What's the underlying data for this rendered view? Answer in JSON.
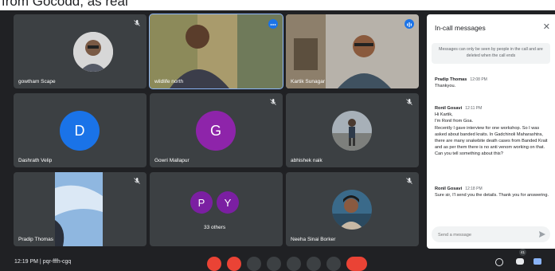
{
  "banner": {
    "text": "from Gocodd, as real"
  },
  "tiles": [
    {
      "name": "gowtham Scape"
    },
    {
      "name": "wildlife north"
    },
    {
      "name": "Kartik Sunagar"
    },
    {
      "name": "Dashrath Velip",
      "initial": "D",
      "color": "#1a73e8"
    },
    {
      "name": "Gowri Mallapur",
      "initial": "G",
      "color": "#8e24aa"
    },
    {
      "name": "abhishek naik"
    },
    {
      "name": "Pradip Thomas"
    },
    {
      "name": "33 others",
      "initials": [
        "P",
        "Y"
      ],
      "colors": [
        "#7b1fa2",
        "#7b1fa2"
      ]
    },
    {
      "name": "Neeha Sinai Borker"
    }
  ],
  "panel": {
    "title": "In-call messages",
    "note": "Messages can only be seen by people in the call and are deleted when the call ends",
    "messages": [
      {
        "sender": "Pradip Thomas",
        "time": "12:08 PM",
        "text": "Thankyou."
      },
      {
        "sender": "Ronil Gosavi",
        "time": "12:11 PM",
        "text": "Hi Kartik,\nI'm Ronil from Goa.\nRecently I gave interview for one workshop. So I was asked about banded kraits. In Gadchinoli Maharashtra, there are many snakebite death cases from Banded Krait and as per them there is no anti venom working on that. Can you tell something about this?"
      },
      {
        "sender": "Ronil Gosavi",
        "time": "12:18 PM",
        "text": "Sure sir, I'l send you the details. Thank you  for answering."
      }
    ],
    "input_placeholder": "Send a message"
  },
  "bottom": {
    "time": "12:19 PM",
    "meeting_code": "pqr-fffh-cgq",
    "people_badge": "41"
  },
  "colors": {
    "background": "#202124",
    "tile": "#3c4043",
    "accent": "#1a73e8",
    "danger": "#ea4335"
  }
}
